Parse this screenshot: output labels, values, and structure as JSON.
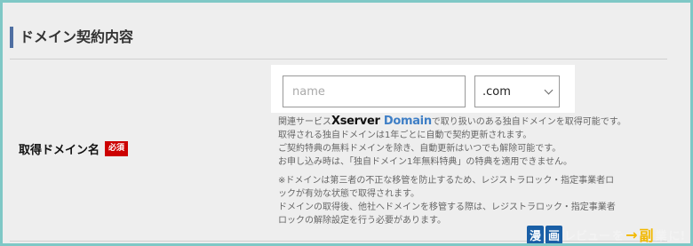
{
  "section": {
    "title": "ドメイン契約内容"
  },
  "field": {
    "label": "取得ドメイン名",
    "required_badge": "必須"
  },
  "domain_input": {
    "placeholder": "name",
    "value": ""
  },
  "tld_select": {
    "selected": ".com"
  },
  "notes": {
    "line1_prefix": "関連サービス",
    "logo_x": "Xserver",
    "logo_domain": "Domain",
    "line1_suffix": "で取り扱いのある独自ドメインを取得可能です。",
    "line2": "取得される独自ドメインは1年ごとに自動で契約更新されます。",
    "line3": "ご契約特典の無料ドメインを除き、自動更新はいつでも解除可能です。",
    "line4": "お申し込み時は、「独自ドメイン1年無料特典」の特典を適用できません。",
    "line5": "※ドメインは第三者の不正な移管を防止するため、レジストラロック・指定事業者ロ",
    "line6": "ックが有効な状態で取得されます。",
    "line7": "ドメインの取得後、他社へドメインを移管する際は、レジストラロック・指定事業者",
    "line8": "ロックの解除設定を行う必要があります。"
  },
  "watermark": {
    "kanji1": "漫",
    "kanji2": "画",
    "mid": "レビュー",
    "wo": "を",
    "arrow": "→",
    "fuku": "副",
    "gyou": "業",
    "ni": "に!"
  }
}
